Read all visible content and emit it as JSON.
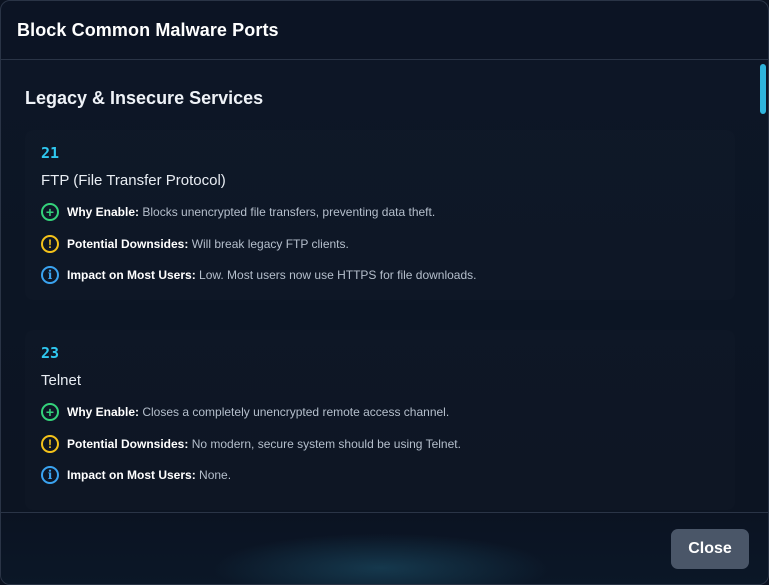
{
  "dialog": {
    "title": "Block Common Malware Ports",
    "close_label": "Close"
  },
  "section": {
    "title": "Legacy & Insecure Services"
  },
  "ports": [
    {
      "port": "21",
      "name": "FTP (File Transfer Protocol)",
      "why_label": "Why Enable:",
      "why_text": " Blocks unencrypted file transfers, preventing data theft.",
      "downside_label": "Potential Downsides:",
      "downside_text": " Will break legacy FTP clients.",
      "impact_label": "Impact on Most Users:",
      "impact_text": " Low. Most users now use HTTPS for file downloads."
    },
    {
      "port": "23",
      "name": "Telnet",
      "why_label": "Why Enable:",
      "why_text": " Closes a completely unencrypted remote access channel.",
      "downside_label": "Potential Downsides:",
      "downside_text": " No modern, secure system should be using Telnet.",
      "impact_label": "Impact on Most Users:",
      "impact_text": " None."
    }
  ],
  "icons": {
    "why": "plus-circle-icon",
    "downside": "warning-circle-icon",
    "impact": "info-circle-icon"
  },
  "colors": {
    "accent": "#2fc8f0",
    "green": "#34d27b",
    "yellow": "#f4c21a",
    "blue": "#3aa3f0",
    "button": "#4a5668"
  }
}
